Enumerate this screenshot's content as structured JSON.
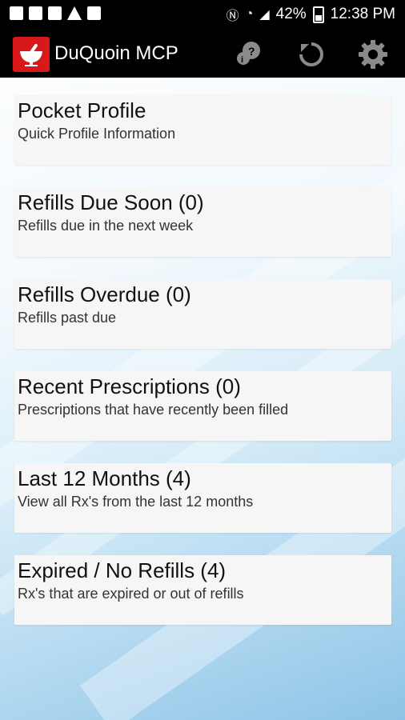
{
  "status_bar": {
    "battery": "42%",
    "time": "12:38 PM",
    "icons_left": [
      "gallery-icon",
      "flipboard-icon",
      "flipboard-icon",
      "warning-icon",
      "rx-icon"
    ],
    "icons_right": [
      "nfc-icon",
      "wifi-icon",
      "signal-icon",
      "battery-icon"
    ]
  },
  "app_bar": {
    "title": "DuQuoin MCP",
    "brand_color": "#d7191c",
    "actions": [
      "help-icon",
      "refresh-icon",
      "settings-icon"
    ]
  },
  "cards": [
    {
      "title": "Pocket Profile",
      "subtitle": "Quick Profile Information"
    },
    {
      "title": "Refills Due Soon (0)",
      "subtitle": "Refills due in the next week"
    },
    {
      "title": "Refills Overdue (0)",
      "subtitle": "Refills past due"
    },
    {
      "title": "Recent Prescriptions (0)",
      "subtitle": "Prescriptions that have recently been filled"
    },
    {
      "title": "Last 12 Months (4)",
      "subtitle": "View all Rx's from the last 12 months"
    },
    {
      "title": "Expired / No Refills (4)",
      "subtitle": "Rx's that are expired or out of refills"
    }
  ]
}
